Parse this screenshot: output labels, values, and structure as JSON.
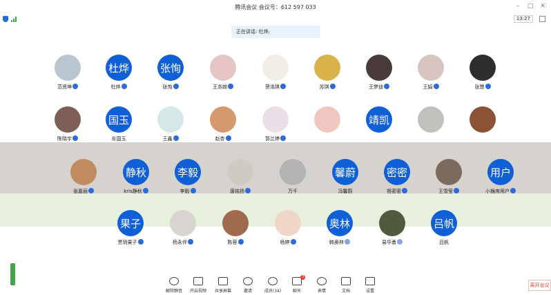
{
  "window": {
    "title": "腾讯会议  会议号：612 597 033",
    "clock": "13:27"
  },
  "speaking": "正在讲话: 杜烨;",
  "leave_label": "离开会议",
  "colors": {
    "accent": "#0f5fd7",
    "leave": "#e44a3a",
    "signal": "#33b14a"
  },
  "participants": [
    [
      {
        "name": "范贤坤",
        "avatar": "photo",
        "color": "#b9c6cf",
        "mic": "on"
      },
      {
        "name": "杜烨",
        "avatar": "text",
        "text": "杜烨",
        "mic": "host"
      },
      {
        "name": "张恂",
        "avatar": "text",
        "text": "张恂",
        "mic": "on"
      },
      {
        "name": "王苏婉",
        "avatar": "photo",
        "color": "#e6c5c7",
        "mic": "on"
      },
      {
        "name": "贺浩琪",
        "avatar": "photo",
        "color": "#f1ede6",
        "mic": "on"
      },
      {
        "name": "苏琪",
        "avatar": "photo",
        "color": "#d9b34a",
        "mic": "on"
      },
      {
        "name": "王梦迪",
        "avatar": "photo",
        "color": "#4a3a3a",
        "mic": "on"
      },
      {
        "name": "王娟",
        "avatar": "photo",
        "color": "#d7c4c0",
        "mic": "on"
      },
      {
        "name": "张慧",
        "avatar": "photo",
        "color": "#2e2e2e",
        "mic": "on"
      }
    ],
    [
      {
        "name": "陈晓宇",
        "avatar": "photo",
        "color": "#7d5f57",
        "mic": "on"
      },
      {
        "name": "牟国玉",
        "avatar": "text",
        "text": "国玉",
        "mic": "none"
      },
      {
        "name": "王鑫",
        "avatar": "photo",
        "color": "#d5e7e7",
        "mic": "on"
      },
      {
        "name": "赵杏",
        "avatar": "photo",
        "color": "#d49a6e",
        "mic": "on"
      },
      {
        "name": "郭兰婷",
        "avatar": "photo",
        "color": "#eadfe6",
        "mic": "on"
      },
      {
        "name": "",
        "avatar": "photo",
        "color": "#f0c7c0",
        "mic": "on"
      },
      {
        "name": "",
        "avatar": "text",
        "text": "靖凯",
        "mic": "on"
      },
      {
        "name": "",
        "avatar": "photo",
        "color": "#bfc1bd",
        "mic": "on"
      },
      {
        "name": "",
        "avatar": "photo",
        "color": "#8b5236",
        "mic": "on"
      }
    ],
    [
      {
        "name": "张嘉丽",
        "avatar": "photo",
        "color": "#c08b60",
        "mic": "on"
      },
      {
        "name": "kris静秋",
        "avatar": "text",
        "text": "静秋",
        "mic": "on"
      },
      {
        "name": "李毅",
        "avatar": "text",
        "text": "李毅",
        "mic": "on"
      },
      {
        "name": "唐铭扬",
        "avatar": "photo",
        "color": "#cfcac4",
        "mic": "on"
      },
      {
        "name": "万千",
        "avatar": "photo",
        "color": "#b3b3b3",
        "mic": "none"
      },
      {
        "name": "冯馨蔚",
        "avatar": "text",
        "text": "馨蔚",
        "mic": "none"
      },
      {
        "name": "祖密密",
        "avatar": "text",
        "text": "密密",
        "mic": "on"
      },
      {
        "name": "王雪莹",
        "avatar": "photo",
        "color": "#7c6a5f",
        "mic": "on"
      },
      {
        "name": "小猴席用户",
        "avatar": "text",
        "text": "用户",
        "mic": "on"
      }
    ],
    [
      {
        "name": "贾玥果子",
        "avatar": "text",
        "text": "果子",
        "mic": "on"
      },
      {
        "name": "杨永伴",
        "avatar": "photo",
        "color": "#d8d4cf",
        "mic": "on"
      },
      {
        "name": "陈蓉",
        "avatar": "photo",
        "color": "#a06a4e",
        "mic": "on"
      },
      {
        "name": "杨婷",
        "avatar": "photo",
        "color": "#f0d6c8",
        "mic": "on"
      },
      {
        "name": "韩奥林",
        "avatar": "text",
        "text": "奥林",
        "mic": "muted"
      },
      {
        "name": "易华勇",
        "avatar": "photo",
        "color": "#4f5a3e",
        "mic": "muted"
      },
      {
        "name": "吕帆",
        "avatar": "text",
        "text": "吕帆",
        "mic": "none"
      }
    ]
  ],
  "toolbar": [
    {
      "label": "解除静音",
      "icon": "mic-off-icon",
      "shape": "round"
    },
    {
      "label": "开启视频",
      "icon": "camera-off-icon",
      "shape": "box"
    },
    {
      "label": "共享屏幕",
      "icon": "share-screen-icon",
      "shape": "box"
    },
    {
      "label": "邀请",
      "icon": "invite-icon",
      "shape": "round"
    },
    {
      "label": "成员(34)",
      "icon": "members-icon",
      "shape": "round"
    },
    {
      "label": "聊天",
      "icon": "chat-icon",
      "shape": "box",
      "badge": "3"
    },
    {
      "label": "表情",
      "icon": "emoji-icon",
      "shape": "round"
    },
    {
      "label": "文档",
      "icon": "document-icon",
      "shape": "box"
    },
    {
      "label": "设置",
      "icon": "settings-icon",
      "shape": "box"
    }
  ]
}
